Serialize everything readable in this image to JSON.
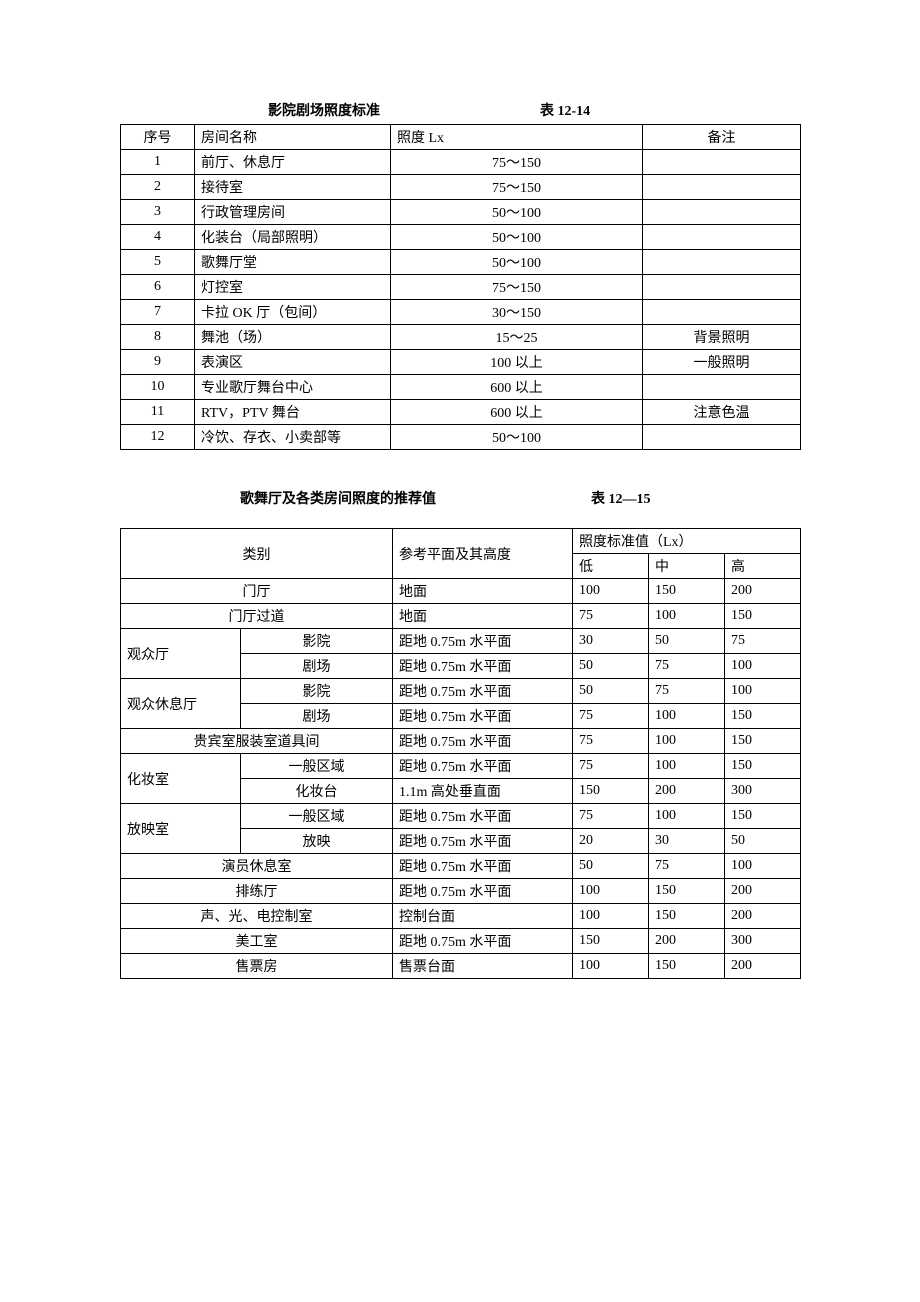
{
  "table1": {
    "title": "影院剧场照度标准",
    "number": "表 12-14",
    "headers": {
      "seq": "序号",
      "room": "房间名称",
      "lux": "照度 Lx",
      "remark": "备注"
    },
    "rows": [
      {
        "seq": "1",
        "room": "前厅、休息厅",
        "lux": "75～150",
        "remark": ""
      },
      {
        "seq": "2",
        "room": "接待室",
        "lux": "75～150",
        "remark": ""
      },
      {
        "seq": "3",
        "room": "行政管理房间",
        "lux": "50～100",
        "remark": ""
      },
      {
        "seq": "4",
        "room": "化装台（局部照明）",
        "lux": "50～100",
        "remark": ""
      },
      {
        "seq": "5",
        "room": "歌舞厅堂",
        "lux": "50～100",
        "remark": ""
      },
      {
        "seq": "6",
        "room": "灯控室",
        "lux": "75～150",
        "remark": ""
      },
      {
        "seq": "7",
        "room": "卡拉 OK 厅（包间）",
        "lux": "30～150",
        "remark": ""
      },
      {
        "seq": "8",
        "room": "舞池（场）",
        "lux": "15～25",
        "remark": "背景照明"
      },
      {
        "seq": "9",
        "room": "表演区",
        "lux": "100 以上",
        "remark": "一般照明"
      },
      {
        "seq": "10",
        "room": "专业歌厅舞台中心",
        "lux": "600 以上",
        "remark": ""
      },
      {
        "seq": "11",
        "room": "RTV，PTV 舞台",
        "lux": "600 以上",
        "remark": "注意色温"
      },
      {
        "seq": "12",
        "room": "冷饮、存衣、小卖部等",
        "lux": "50～100",
        "remark": ""
      }
    ]
  },
  "table2": {
    "title": "歌舞厅及各类房间照度的推荐值",
    "number": "表 12—15",
    "headers": {
      "cat": "类别",
      "ref": "参考平面及其高度",
      "std": "照度标准值（Lx）",
      "low": "低",
      "mid": "中",
      "high": "高"
    },
    "rows": [
      {
        "a": "门厅",
        "aspan": 2,
        "b": null,
        "ref": "地面",
        "low": "100",
        "mid": "150",
        "high": "200"
      },
      {
        "a": "门厅过道",
        "aspan": 2,
        "b": null,
        "ref": "地面",
        "low": "75",
        "mid": "100",
        "high": "150"
      },
      {
        "a": "观众厅",
        "aRows": 2,
        "b": "影院",
        "ref": "距地 0.75m 水平面",
        "low": "30",
        "mid": "50",
        "high": "75"
      },
      {
        "a": null,
        "b": "剧场",
        "ref": "距地 0.75m 水平面",
        "low": "50",
        "mid": "75",
        "high": "100"
      },
      {
        "a": "观众休息厅",
        "aRows": 2,
        "b": "影院",
        "ref": "距地 0.75m 水平面",
        "low": "50",
        "mid": "75",
        "high": "100"
      },
      {
        "a": null,
        "b": "剧场",
        "ref": "距地 0.75m 水平面",
        "low": "75",
        "mid": "100",
        "high": "150"
      },
      {
        "a": "贵宾室服装室道具间",
        "aspan": 2,
        "b": null,
        "ref": "距地 0.75m 水平面",
        "low": "75",
        "mid": "100",
        "high": "150"
      },
      {
        "a": "化妆室",
        "aRows": 2,
        "b": "一般区域",
        "ref": "距地 0.75m 水平面",
        "low": "75",
        "mid": "100",
        "high": "150"
      },
      {
        "a": null,
        "b": "化妆台",
        "ref": "1.1m 高处垂直面",
        "low": "150",
        "mid": "200",
        "high": "300"
      },
      {
        "a": "放映室",
        "aRows": 2,
        "b": "一般区域",
        "ref": "距地 0.75m 水平面",
        "low": "75",
        "mid": "100",
        "high": "150"
      },
      {
        "a": null,
        "b": "放映",
        "ref": "距地 0.75m 水平面",
        "low": "20",
        "mid": "30",
        "high": "50"
      },
      {
        "a": "演员休息室",
        "aspan": 2,
        "b": null,
        "ref": "距地 0.75m 水平面",
        "low": "50",
        "mid": "75",
        "high": "100"
      },
      {
        "a": "排练厅",
        "aspan": 2,
        "b": null,
        "ref": "距地 0.75m 水平面",
        "low": "100",
        "mid": "150",
        "high": "200"
      },
      {
        "a": "声、光、电控制室",
        "aspan": 2,
        "b": null,
        "ref": "控制台面",
        "low": "100",
        "mid": "150",
        "high": "200"
      },
      {
        "a": "美工室",
        "aspan": 2,
        "b": null,
        "ref": "距地 0.75m 水平面",
        "low": "150",
        "mid": "200",
        "high": "300"
      },
      {
        "a": "售票房",
        "aspan": 2,
        "b": null,
        "ref": "售票台面",
        "low": "100",
        "mid": "150",
        "high": "200"
      }
    ]
  }
}
